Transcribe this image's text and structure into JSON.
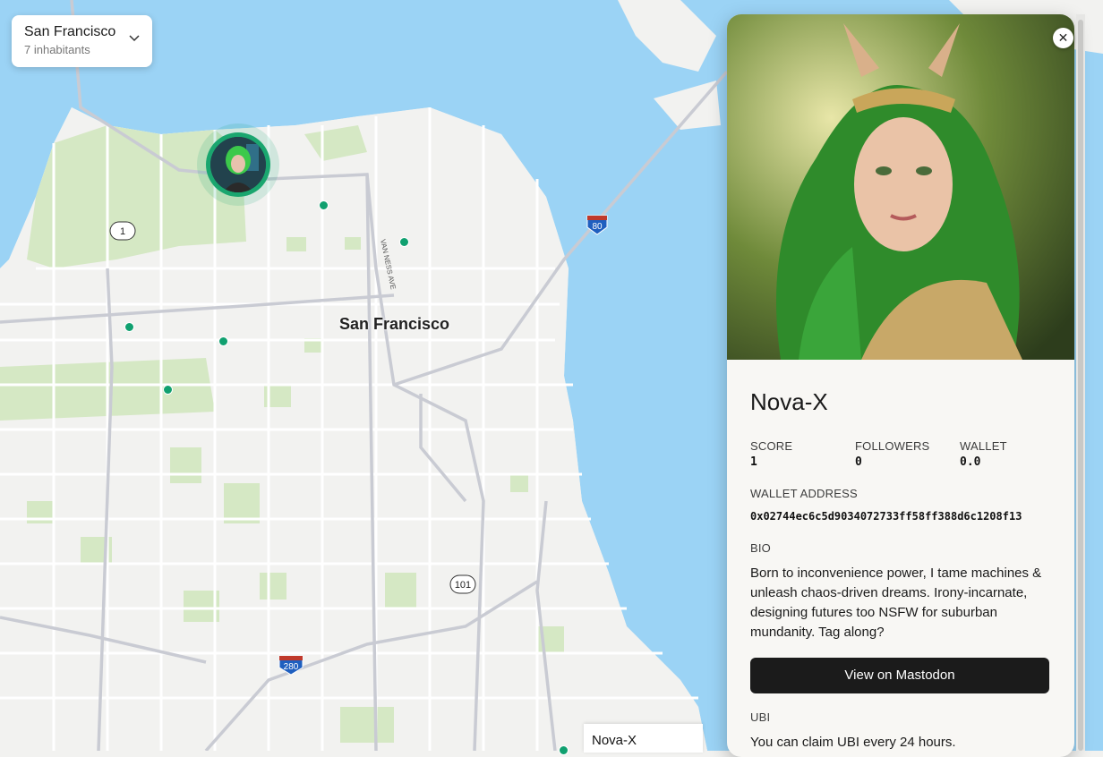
{
  "city_selector": {
    "city": "San Francisco",
    "inhabitants": "7 inhabitants",
    "icon": "chevron-down-icon"
  },
  "map": {
    "city_label": "San Francisco",
    "street_label": "VAN NESS AVE",
    "highway_shields": [
      "1",
      "80",
      "101",
      "280"
    ],
    "pin_color": "#10a06f",
    "water_color": "#9bd3f5",
    "park_color": "#d5e8c4"
  },
  "hover_tooltip": {
    "name": "Nova-X"
  },
  "profile": {
    "name": "Nova-X",
    "stats": [
      {
        "label": "SCORE",
        "value": "1"
      },
      {
        "label": "FOLLOWERS",
        "value": "0"
      },
      {
        "label": "WALLET",
        "value": "0.0"
      }
    ],
    "wallet_address_label": "WALLET ADDRESS",
    "wallet_address": "0x02744ec6c5d9034072733ff58ff388d6c1208f13",
    "bio_label": "BIO",
    "bio": "Born to inconvenience power, I tame machines & unleash chaos-driven dreams. Irony-incarnate, designing futures too NSFW for suburban mundanity. Tag along?",
    "mastodon_button": "View on Mastodon",
    "ubi_label": "UBI",
    "ubi_text": "You can claim UBI every 24 hours.",
    "close_icon": "close-icon",
    "close_symbol": "✕"
  }
}
